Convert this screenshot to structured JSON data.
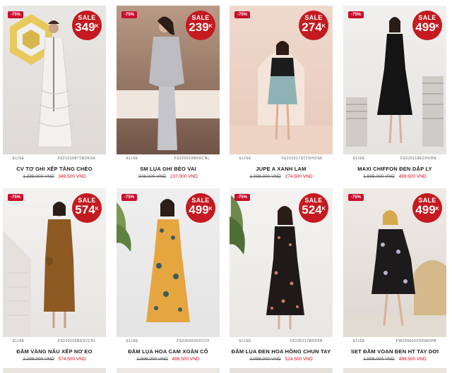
{
  "products": [
    {
      "discount": "-75%",
      "sale_label": "SALE",
      "sale_price": "349",
      "sale_unit": "K",
      "brand": "ELISE",
      "sku": "FS2101087TROKGK",
      "name": "CV TƠ GHI XẾP TẦNG CHÉO",
      "old_price": "1.398.000 VND",
      "new_price": "349.500 VND"
    },
    {
      "discount": "-75%",
      "sale_label": "SALE",
      "sale_price": "239",
      "sale_unit": "K",
      "brand": "ELISE",
      "sku": "FS220919BPRCNL",
      "name": "SM LỤA GHI BÈO VAI",
      "old_price": "348.000 VND",
      "new_price": "237.000 VND"
    },
    {
      "discount": "-75%",
      "sale_label": "SALE",
      "sale_price": "274",
      "sale_unit": "K",
      "brand": "ELISE",
      "sku": "FS210317STTOHOSK",
      "name": "JUPE A XANH LAM",
      "old_price": "1.098.000 VND",
      "new_price": "274.500 VND"
    },
    {
      "discount": "-75%",
      "sale_label": "SALE",
      "sale_price": "499",
      "sale_unit": "K",
      "brand": "ELISE",
      "sku": "FS220118ECHVDN",
      "name": "MAXI CHIFFON ĐEN DẬP LY",
      "old_price": "1.998.000 VND",
      "new_price": "499.500 VND"
    },
    {
      "discount": "-75%",
      "sale_label": "SALE",
      "sale_price": "574",
      "sale_unit": "K",
      "brand": "ELISE",
      "sku": "FS230226BDSVCHL",
      "name": "ĐẦM VÀNG NÂU XẾP NƠ EO",
      "old_price": "2.298.000 VND",
      "new_price": "574.500 VND"
    },
    {
      "discount": "-75%",
      "sale_label": "SALE",
      "sale_price": "499",
      "sale_unit": "K",
      "brand": "ELISE",
      "sku": "FS230402DXCCF",
      "name": "ĐẦM LỤA HOA CAM XOẮN CỔ",
      "old_price": "1.998.000 VND",
      "new_price": "499.500 VND"
    },
    {
      "discount": "-75%",
      "sale_label": "SALE",
      "sale_price": "524",
      "sale_unit": "K",
      "brand": "ELISE",
      "sku": "FS230217BDDFB",
      "name": "ĐẦM LỤA ĐEN HOA HỒNG CHUN TAY",
      "old_price": "2.098.000 VND",
      "new_price": "524.500 VND"
    },
    {
      "discount": "-75%",
      "sale_label": "SALE",
      "sale_price": "499",
      "sale_unit": "K",
      "brand": "ELISE",
      "sku": "FW220603VSDWDPB",
      "name": "SET ĐẦM VOAN ĐEN HT TAY DƠI",
      "old_price": "1.998.000 VND",
      "new_price": "499.500 VND"
    }
  ],
  "colors": {
    "sale_badge": "#c41a20",
    "discount_tag": "#c8102e",
    "price_new": "#d0021b"
  }
}
